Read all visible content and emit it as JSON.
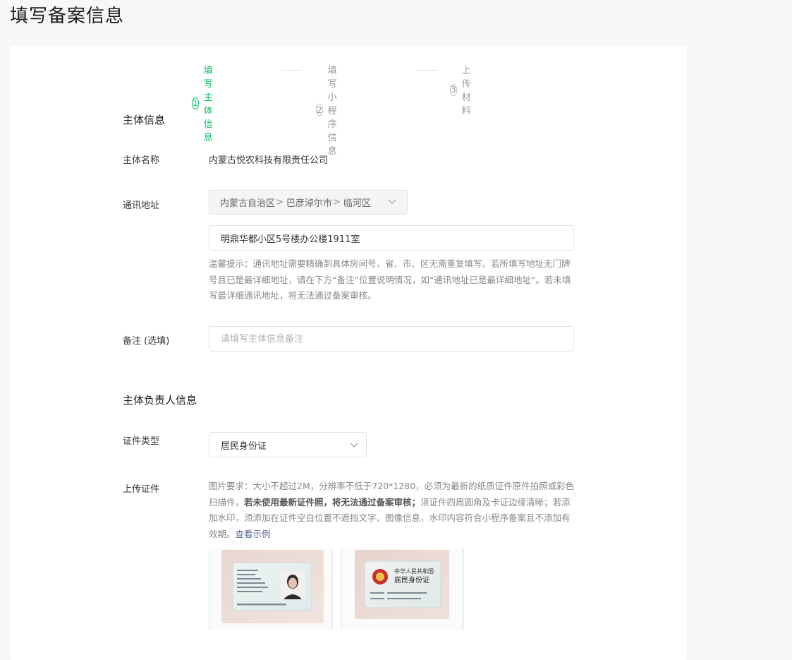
{
  "page": {
    "title": "填写备案信息"
  },
  "steps": [
    {
      "num": "1",
      "label": "填写主体信息",
      "active": true
    },
    {
      "num": "2",
      "label": "填写小程序信息",
      "active": false
    },
    {
      "num": "3",
      "label": "上传材料",
      "active": false
    }
  ],
  "subject_info": {
    "section_title": "主体信息",
    "name_label": "主体名称",
    "name_value": "内蒙古悦农科技有限责任公司",
    "address_label": "通讯地址",
    "region": {
      "province": "内蒙古自治区",
      "city": "巴彦淖尔市",
      "district": "临河区",
      "sep": ">"
    },
    "address_detail": "明鼎华都小区5号楼办公楼1911室",
    "address_tip": "温馨提示：通讯地址需要精确到具体房间号，省、市、区无需重复填写。若所填写地址无门牌号且已是最详细地址，请在下方“备注”位置说明情况，如“通讯地址已是最详细地址“。若未填写最详细通讯地址，将无法通过备案审核。",
    "remark_label": "备注 (选填)",
    "remark_placeholder": "请填写主体信息备注"
  },
  "principal_info": {
    "section_title": "主体负责人信息",
    "id_type_label": "证件类型",
    "id_type_value": "居民身份证",
    "upload_label": "上传证件",
    "upload_tip_1": "图片要求：大小不超过2M，分辨率不低于720*1280，必须为最新的纸质证件原件拍照或彩色扫描件，",
    "upload_tip_bold": "若未使用最新证件照，将无法通过备案审核；",
    "upload_tip_2": "须证件四周圆角及卡证边缘清晰；若添加水印，须添加在证件空白位置不遮挡文字、图像信息，水印内容符合小程序备案且不添加有效期。",
    "view_example": "查看示例",
    "sample_back_title": "中华人民共和国",
    "sample_back_subtitle": "居民身份证"
  },
  "colors": {
    "accent": "#07c160",
    "link": "#576b95",
    "muted": "#888888"
  },
  "icons": [
    "chevron-down-icon",
    "id-card-front-image",
    "id-card-back-image",
    "national-emblem-icon",
    "portrait-image"
  ]
}
